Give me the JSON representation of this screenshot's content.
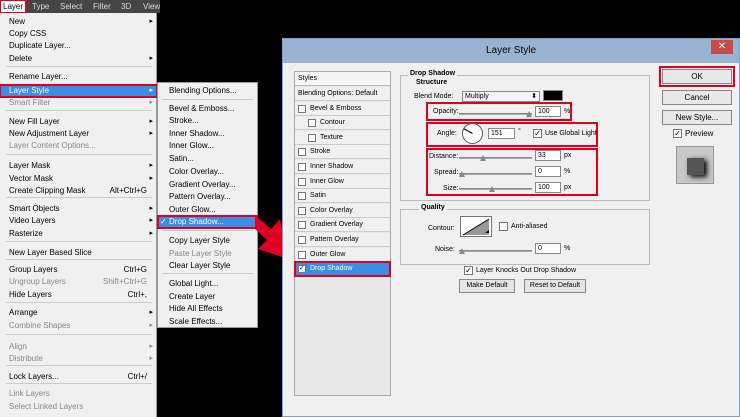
{
  "menubar": {
    "items": [
      "Layer",
      "Type",
      "Select",
      "Filter",
      "3D",
      "View"
    ]
  },
  "main_menu": [
    {
      "label": "New",
      "arrow": true
    },
    {
      "label": "Copy CSS"
    },
    {
      "label": "Duplicate Layer..."
    },
    {
      "label": "Delete",
      "arrow": true
    },
    {
      "label": "Rename Layer..."
    },
    {
      "label": "Layer Style",
      "arrow": true,
      "highlight": true
    },
    {
      "label": "Smart Filter",
      "arrow": true,
      "disabled": true
    },
    {
      "label": "New Fill Layer",
      "arrow": true
    },
    {
      "label": "New Adjustment Layer",
      "arrow": true
    },
    {
      "label": "Layer Content Options...",
      "disabled": true
    },
    {
      "label": "Layer Mask",
      "arrow": true
    },
    {
      "label": "Vector Mask",
      "arrow": true
    },
    {
      "label": "Create Clipping Mask",
      "shortcut": "Alt+Ctrl+G"
    },
    {
      "label": "Smart Objects",
      "arrow": true
    },
    {
      "label": "Video Layers",
      "arrow": true
    },
    {
      "label": "Rasterize",
      "arrow": true
    },
    {
      "label": "New Layer Based Slice"
    },
    {
      "label": "Group Layers",
      "shortcut": "Ctrl+G"
    },
    {
      "label": "Ungroup Layers",
      "shortcut": "Shift+Ctrl+G",
      "disabled": true
    },
    {
      "label": "Hide Layers",
      "shortcut": "Ctrl+,"
    },
    {
      "label": "Arrange",
      "arrow": true
    },
    {
      "label": "Combine Shapes",
      "arrow": true,
      "disabled": true
    },
    {
      "label": "Align",
      "arrow": true,
      "disabled": true
    },
    {
      "label": "Distribute",
      "arrow": true,
      "disabled": true
    },
    {
      "label": "Lock Layers...",
      "shortcut": "Ctrl+/"
    },
    {
      "label": "Link Layers",
      "disabled": true
    },
    {
      "label": "Select Linked Layers",
      "disabled": true
    }
  ],
  "submenu": [
    {
      "label": "Blending Options..."
    },
    {
      "label": "Bevel & Emboss..."
    },
    {
      "label": "Stroke..."
    },
    {
      "label": "Inner Shadow..."
    },
    {
      "label": "Inner Glow..."
    },
    {
      "label": "Satin..."
    },
    {
      "label": "Color Overlay..."
    },
    {
      "label": "Gradient Overlay..."
    },
    {
      "label": "Pattern Overlay..."
    },
    {
      "label": "Outer Glow..."
    },
    {
      "label": "Drop Shadow...",
      "checked": true,
      "highlight": true
    },
    {
      "label": "Copy Layer Style"
    },
    {
      "label": "Paste Layer Style",
      "disabled": true
    },
    {
      "label": "Clear Layer Style"
    },
    {
      "label": "Global Light..."
    },
    {
      "label": "Create Layer"
    },
    {
      "label": "Hide All Effects"
    },
    {
      "label": "Scale Effects..."
    }
  ],
  "dialog": {
    "title": "Layer Style",
    "close": "✕",
    "styles_header": "Styles",
    "styles": [
      {
        "label": "Blending Options: Default"
      },
      {
        "label": "Bevel & Emboss"
      },
      {
        "label": "Contour"
      },
      {
        "label": "Texture"
      },
      {
        "label": "Stroke"
      },
      {
        "label": "Inner Shadow"
      },
      {
        "label": "Inner Glow"
      },
      {
        "label": "Satin"
      },
      {
        "label": "Color Overlay"
      },
      {
        "label": "Gradient Overlay"
      },
      {
        "label": "Pattern Overlay"
      },
      {
        "label": "Outer Glow"
      },
      {
        "label": "Drop Shadow",
        "checked": true
      }
    ],
    "section_title": "Drop Shadow",
    "structure_title": "Structure",
    "blend_mode_label": "Blend Mode:",
    "blend_mode_value": "Multiply",
    "shadow_color": "#000000",
    "opacity_label": "Opacity:",
    "opacity_value": "100",
    "opacity_fraction": 1.0,
    "angle_label": "Angle:",
    "angle_value": "151",
    "angle_unit": "°",
    "use_global_light": "Use Global Light",
    "distance_label": "Distance:",
    "distance_value": "33",
    "spread_label": "Spread:",
    "spread_value": "0",
    "size_label": "Size:",
    "size_value": "100",
    "percent": "%",
    "px": "px",
    "quality_title": "Quality",
    "contour_label": "Contour:",
    "anti_aliased": "Anti-aliased",
    "noise_label": "Noise:",
    "noise_value": "0",
    "knocks_out": "Layer Knocks Out Drop Shadow",
    "make_default": "Make Default",
    "reset_default": "Reset to Default",
    "ok": "OK",
    "cancel": "Cancel",
    "new_style": "New Style...",
    "preview": "Preview"
  },
  "colors": {
    "highlight": "#3a8ee6",
    "annotation": "#e1001f",
    "titlebar": "#99b4d1"
  }
}
